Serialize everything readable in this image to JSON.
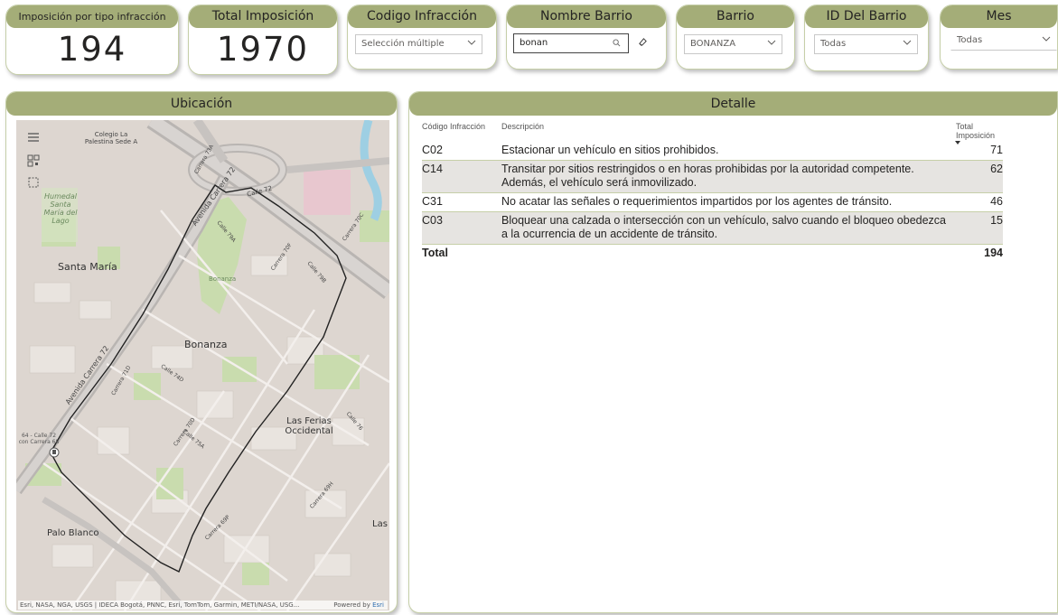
{
  "kpis": [
    {
      "title": "Imposición por tipo infracción",
      "value": "194"
    },
    {
      "title": "Total Imposición",
      "value": "1970"
    }
  ],
  "filters": {
    "codigo_infraccion": {
      "title": "Codigo Infracción",
      "value": "Selección múltiple"
    },
    "nombre_barrio": {
      "title": "Nombre Barrio",
      "search_value": "bonan"
    },
    "barrio": {
      "title": "Barrio",
      "value": "BONANZA"
    },
    "id_barrio": {
      "title": "ID Del Barrio",
      "value": "Todas"
    },
    "mes": {
      "title": "Mes",
      "value": "Todas"
    }
  },
  "map_panel": {
    "title": "Ubicación",
    "labels": {
      "colegio": "Colegio La Palestina Sede A",
      "humedal": "Humedal Santa María del Lago",
      "santa_maria": "Santa María",
      "bonanza_park": "Bonanza",
      "bonanza": "Bonanza",
      "las_ferias": "Las Ferias Occidental",
      "palo_blanco": "Palo Blanco",
      "las": "Las",
      "stop": "64 - Calle 72 con Carrera 68",
      "av_carrera_72_a": "Avenida Carrera 72",
      "av_carrera_72_b": "Avenida Carrera 72",
      "calle_72": "Calle 72",
      "carrera_73a": "Carrera 73A",
      "carrera_71d": "Carrera 71D",
      "calle_74d": "Calle 74D",
      "carrera_70f": "Carrera 70F",
      "carrera_70c": "Carrera 70C",
      "calle_79a": "Calle 79A",
      "calle_79b": "Calle 79B",
      "calle_76": "Calle 76",
      "carrera_70d": "Carrera 70D",
      "calle_75a": "Calle 75A",
      "carrera_69h": "Carrera 69H",
      "carrera_69p": "Carrera 69P"
    },
    "attribution": "Esri, NASA, NGA, USGS | IDECA Bogotá, PNNC, Esri, TomTom, Garmin, METI/NASA, USG...",
    "powered_by": "Powered by",
    "powered_brand": "Esri"
  },
  "detail_panel": {
    "title": "Detalle",
    "columns": {
      "code": "Código Infracción",
      "description": "Descripción",
      "total": "Total Imposición"
    },
    "rows": [
      {
        "code": "C02",
        "description": "Estacionar un vehículo en sitios prohibidos.",
        "total": "71"
      },
      {
        "code": "C14",
        "description": "Transitar por sitios restringidos o en horas prohibidas por la autoridad competente. Además, el vehículo será inmovilizado.",
        "total": "62"
      },
      {
        "code": "C31",
        "description": "No acatar las señales o requerimientos impartidos por los agentes de tránsito.",
        "total": "46"
      },
      {
        "code": "C03",
        "description": "Bloquear una calzada o intersección con un vehículo, salvo cuando el bloqueo obedezca a la ocurrencia de un accidente de tránsito.",
        "total": "15"
      }
    ],
    "total_label": "Total",
    "total_value": "194"
  },
  "colors": {
    "accent": "#a4ad78",
    "border": "#c6cfa8",
    "row_alt": "#e6e4e1"
  }
}
